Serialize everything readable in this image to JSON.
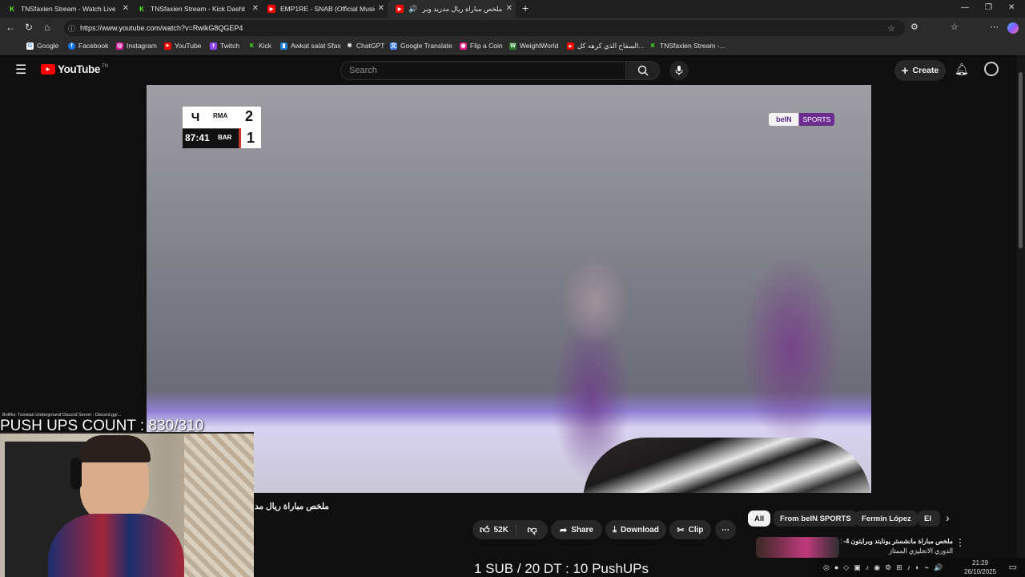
{
  "browser": {
    "tabs": [
      {
        "title": "TNSfaxien Stream - Watch Live on",
        "favicon": "kick-icon",
        "color": "#53fc18"
      },
      {
        "title": "TNSfaxien Stream - Kick Dashboa",
        "favicon": "kick-icon",
        "color": "#53fc18"
      },
      {
        "title": "EMP1RE - SNAB (Official Music V",
        "favicon": "youtube-icon",
        "color": "#ff0000"
      },
      {
        "title": "ملخص مباراة ريال مدريد وبرشـ",
        "favicon": "youtube-icon",
        "color": "#ff0000"
      }
    ],
    "url": "https://www.youtube.com/watch?v=RwlkG8QGEP4",
    "bookmarks": [
      "Google",
      "Facebook",
      "Instagram",
      "YouTube",
      "Twitch",
      "Kick",
      "Awkat salat Sfax",
      "ChatGPT",
      "Google Translate",
      "Flip a Coin",
      "WeightWorld",
      "السفاح الذي كرهه كل...",
      "TNSfaxien Stream -..."
    ]
  },
  "youtube": {
    "logo_text": "YouTube",
    "logo_sup": "TN",
    "search_placeholder": "Search",
    "create_label": "Create",
    "video_title": "ملخص مباراة ريال مد",
    "likes": "52K",
    "share_label": "Share",
    "download_label": "Download",
    "clip_label": "Clip",
    "chips": [
      "All",
      "From beIN SPORTS",
      "Fermín López",
      "El"
    ],
    "side_video_title": "ملخص مباراة مانشستر يونايتد وبرايتون 4- 2",
    "side_video_sub": "الدوري الانجليزي الممتاز"
  },
  "scoreboard": {
    "home": "RMA",
    "away": "BAR",
    "home_score": "2",
    "away_score": "1",
    "clock": "87:41",
    "broadcaster_left": "beIN",
    "broadcaster_right": "SPORTS"
  },
  "overlay": {
    "bot_line": "BotRix: Tunisian Underground Discord Server : Discord.gg/...",
    "pushups_count": "PUSH UPS COUNT : 830/310",
    "sub_rule": "1 SUB / 20 DT : 10 PushUPs"
  },
  "taskbar": {
    "time": "21:29",
    "date": "26/10/2025"
  }
}
